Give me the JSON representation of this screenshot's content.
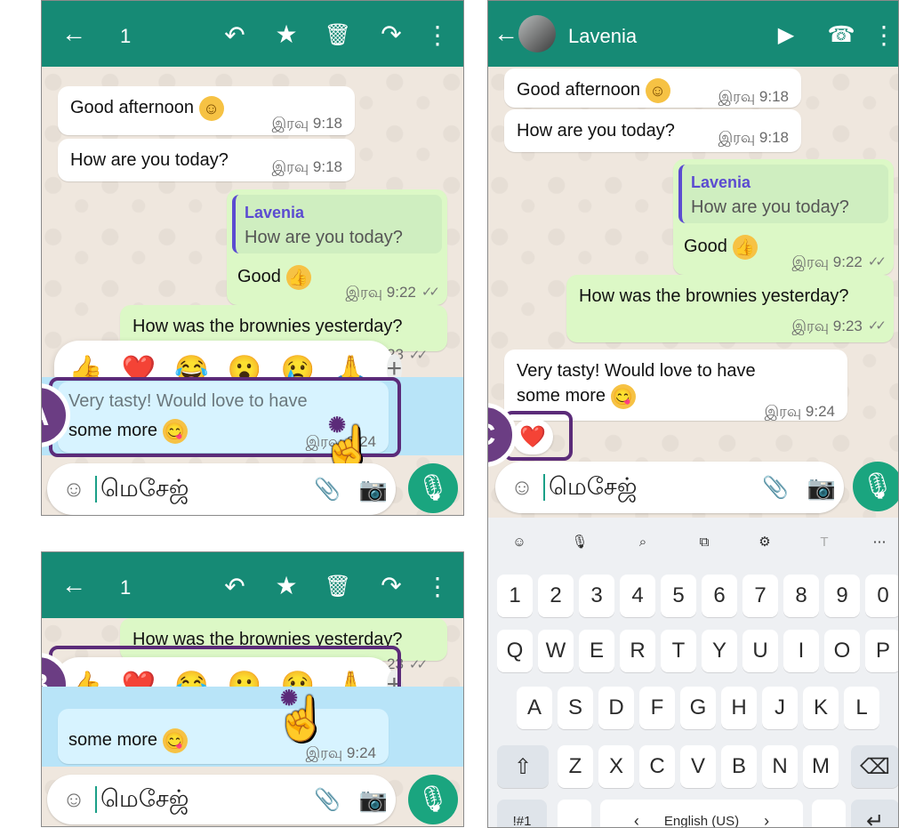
{
  "colors": {
    "header": "#168a75",
    "incoming": "#ffffff",
    "outgoing": "#dcf8c6",
    "selection": "#b8e4f8",
    "marker": "#6b3d83",
    "keyboard": "#eef0f3",
    "mic": "#1aa57f"
  },
  "common": {
    "back_icon": "back-arrow-icon",
    "selected_count": "1",
    "reply_icon": "reply-icon",
    "star_icon": "star-icon",
    "delete_icon": "trash-icon",
    "forward_icon": "forward-icon",
    "menu_icon": "more-vertical-icon",
    "composer_placeholder": "மெசேஜ்",
    "emoji_icon": "emoji-icon",
    "attach_icon": "paperclip-icon",
    "camera_icon": "camera-icon",
    "mic_icon": "microphone-icon"
  },
  "messages": {
    "good_afternoon": "Good afternoon",
    "how_are_you": "How are you today?",
    "reply_name": "Lavenia",
    "good": "Good",
    "brownies": "How was the brownies yesterday?",
    "very_tasty": "Very tasty! Would love to have",
    "some_more": "some more",
    "time_918": "இரவு 9:18",
    "time_922": "இரவு 9:22",
    "time_923": "இரவு 9:23",
    "time_924": "இரவு 9:24",
    "partial_time": "23",
    "tick": "✓✓"
  },
  "reactions": [
    "👍",
    "❤️",
    "😂",
    "😮",
    "😢",
    "🙏",
    "+"
  ],
  "labels": {
    "A": "A",
    "B": "B",
    "C": "C"
  },
  "contact": {
    "name": "Lavenia",
    "video_icon": "video-call-icon",
    "phone_icon": "phone-icon"
  },
  "heart": "❤️",
  "keyboard": {
    "toolbar": [
      "☺",
      "🎙",
      "⌕",
      "⧉",
      "⚙",
      "T",
      "⋯"
    ],
    "numbers": [
      "1",
      "2",
      "3",
      "4",
      "5",
      "6",
      "7",
      "8",
      "9",
      "0"
    ],
    "row1": [
      "Q",
      "W",
      "E",
      "R",
      "T",
      "Y",
      "U",
      "I",
      "O",
      "P"
    ],
    "row2": [
      "A",
      "S",
      "D",
      "F",
      "G",
      "H",
      "J",
      "K",
      "L"
    ],
    "row3": [
      "Z",
      "X",
      "C",
      "V",
      "B",
      "N",
      "M"
    ],
    "shift": "⇧",
    "backspace": "⌫",
    "symbols": "!#1",
    "space_label": "English (US)",
    "left_arrow": "‹",
    "right_arrow": "›",
    "enter": "↵"
  }
}
